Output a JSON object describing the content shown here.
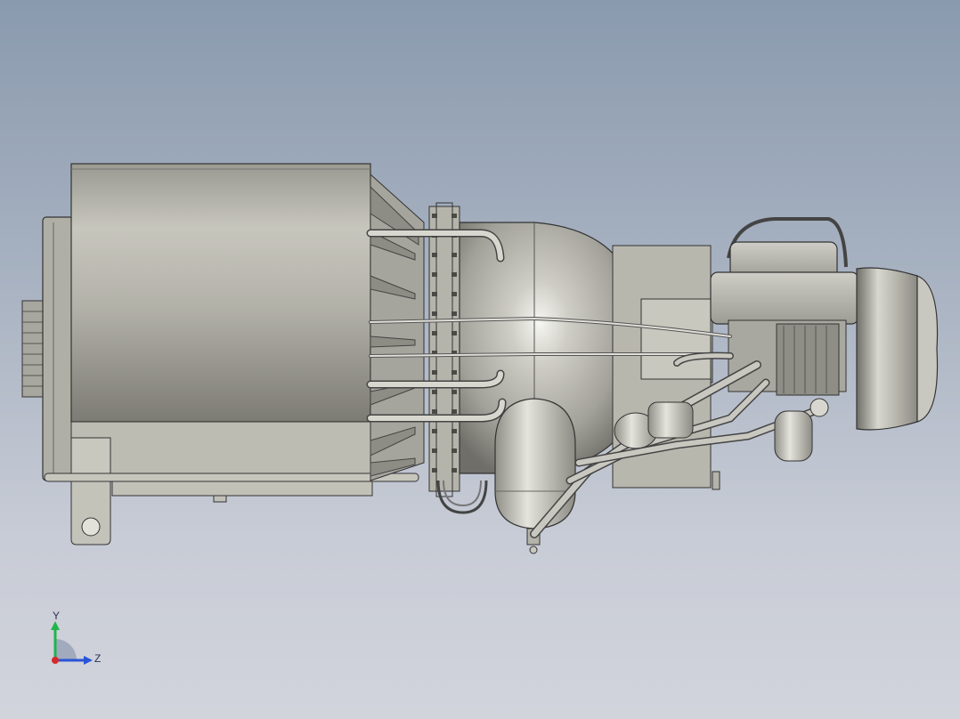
{
  "viewport": {
    "background_top": "#8a9aae",
    "background_bottom": "#d2d4dc",
    "model_icon": "turbine-engine-model"
  },
  "triad": {
    "y_label": "Y",
    "z_label": "Z",
    "y_color": "#1fb54a",
    "z_color": "#2a54d6",
    "x_color": "#d62a2a"
  }
}
